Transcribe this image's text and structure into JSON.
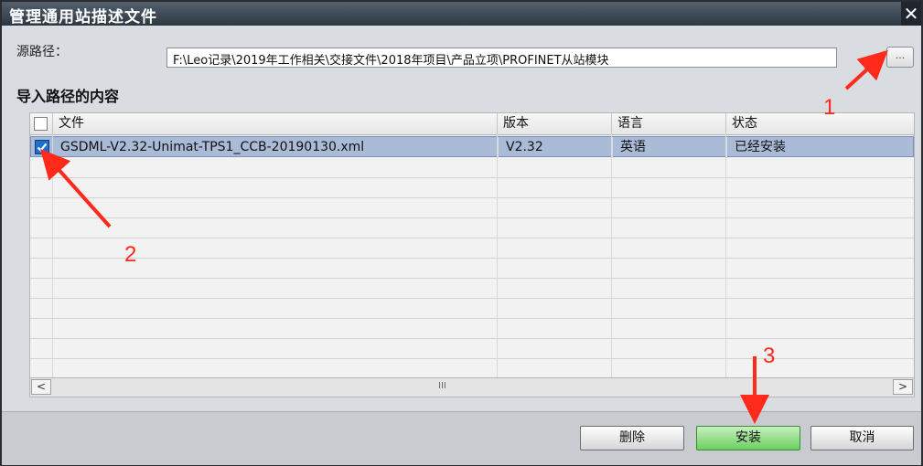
{
  "dialog": {
    "title": "管理通用站描述文件",
    "close_glyph": "✕"
  },
  "source": {
    "label": "源路径：",
    "path": "F:\\Leo记录\\2019年工作相关\\交接文件\\2018年项目\\产品立项\\PROFINET从站模块",
    "browse_label": "..."
  },
  "import_section": {
    "title": "导入路径的内容"
  },
  "table": {
    "columns": [
      "文件",
      "版本",
      "语言",
      "状态"
    ],
    "rows": [
      {
        "checked": true,
        "file": "GSDML-V2.32-Unimat-TPS1_CCB-20190130.xml",
        "version": "V2.32",
        "language": "英语",
        "status": "已经安装"
      }
    ],
    "scroll_left": "<",
    "scroll_right": ">",
    "scroll_grip": "III"
  },
  "buttons": {
    "delete": "删除",
    "install": "安装",
    "cancel": "取消"
  },
  "annotations": {
    "marker_1": "1",
    "marker_2": "2",
    "marker_3": "3",
    "color": "#ff2a1a"
  },
  "colors": {
    "titlebar": "#2c3742",
    "selected_row": "#aabbd8",
    "install_button": "#6bcf5f",
    "checkbox_checked": "#1f6fd0"
  }
}
